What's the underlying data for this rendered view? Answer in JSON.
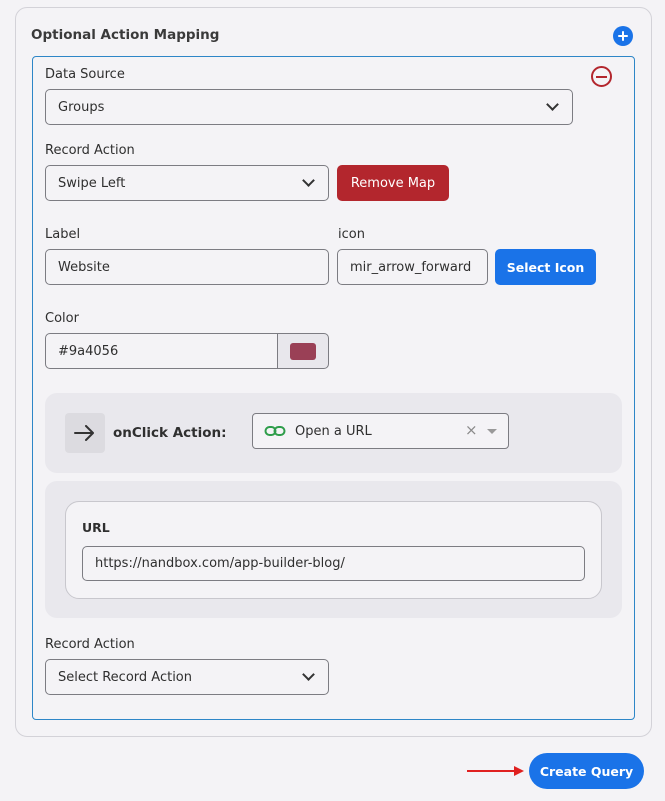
{
  "section": {
    "title": "Optional Action Mapping"
  },
  "form": {
    "data_source": {
      "label": "Data Source",
      "value": "Groups"
    },
    "record_action": {
      "label": "Record Action",
      "value": "Swipe Left"
    },
    "remove_map_label": "Remove Map",
    "label_field": {
      "label": "Label",
      "value": "Website"
    },
    "icon_field": {
      "label": "icon",
      "value": "mir_arrow_forward"
    },
    "select_icon_label": "Select Icon",
    "color_field": {
      "label": "Color",
      "value": "#9a4056",
      "swatch": "#9a4056"
    },
    "onclick": {
      "label": "onClick Action:",
      "value": "Open a URL",
      "clear": "×"
    },
    "url": {
      "label": "URL",
      "value": "https://nandbox.com/app-builder-blog/"
    },
    "record_action_2": {
      "label": "Record Action",
      "value": "Select Record Action"
    }
  },
  "footer": {
    "create_query_label": "Create Query"
  },
  "colors": {
    "accent": "#1a73e8",
    "danger": "#b3262d",
    "link_icon": "#2e9d4a"
  },
  "icons": [
    "plus-circle-icon",
    "minus-circle-icon",
    "chevron-down-icon",
    "arrow-right-icon",
    "link-icon",
    "close-icon",
    "caret-down-icon",
    "red-arrow-icon"
  ]
}
